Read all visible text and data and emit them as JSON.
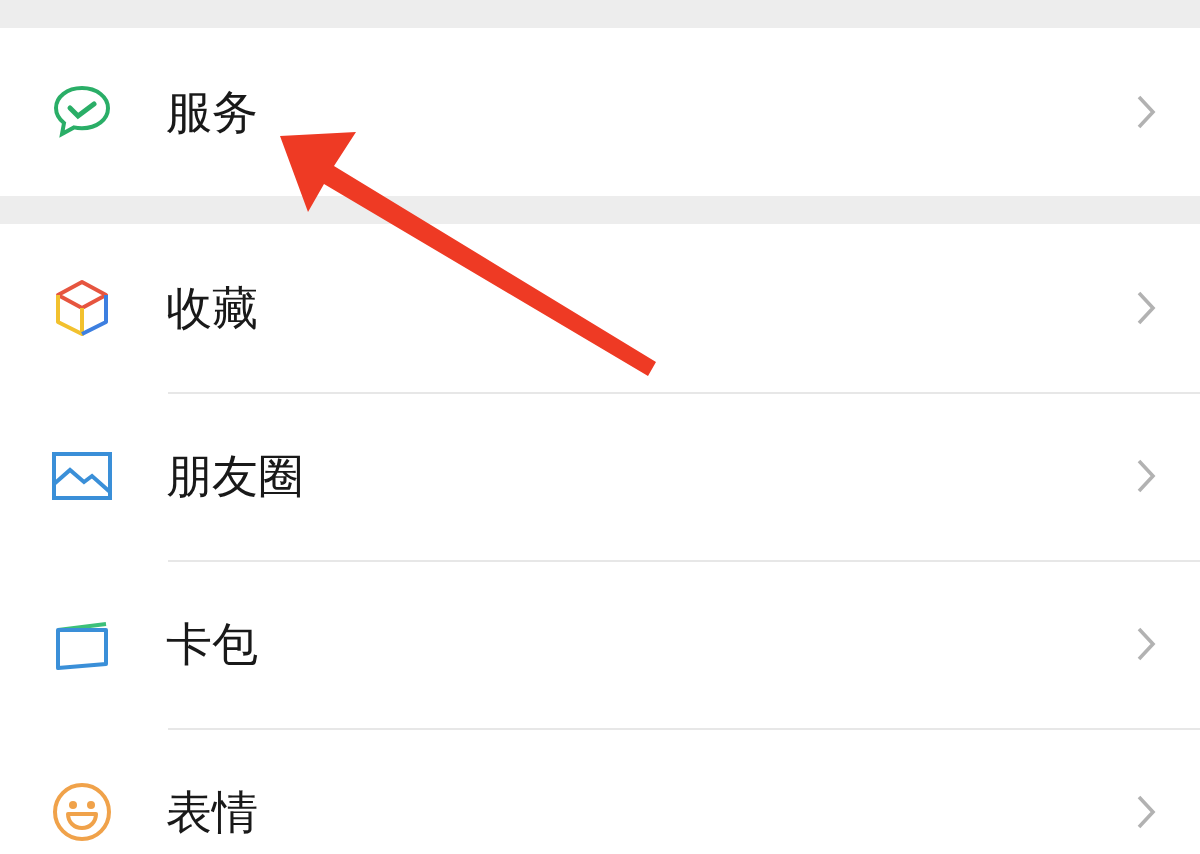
{
  "groups": [
    {
      "items": [
        {
          "kind": "service",
          "label": "服务"
        }
      ]
    },
    {
      "items": [
        {
          "kind": "favorites",
          "label": "收藏"
        },
        {
          "kind": "moments",
          "label": "朋友圈"
        },
        {
          "kind": "cards",
          "label": "卡包"
        },
        {
          "kind": "stickers",
          "label": "表情"
        }
      ]
    }
  ]
}
